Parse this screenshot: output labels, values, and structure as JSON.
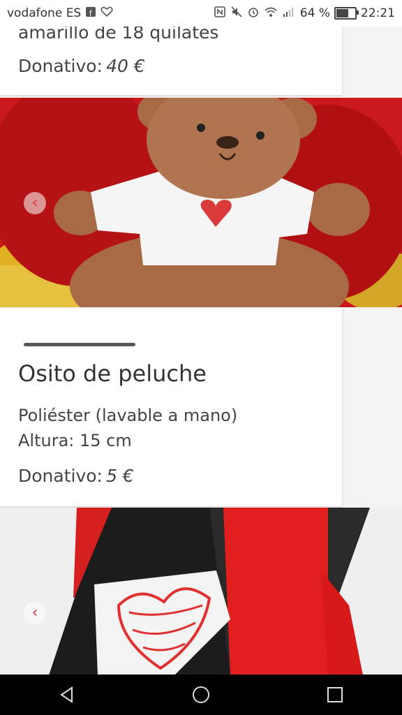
{
  "status_bar": {
    "carrier": "vodafone ES",
    "battery_percent": "64 %",
    "time": "22:21",
    "icons": [
      "facebook-icon",
      "heart-icon",
      "nfc-icon",
      "mute-icon",
      "alarm-icon",
      "wifi-icon",
      "signal-icon",
      "battery-icon"
    ]
  },
  "products": [
    {
      "partial_text": "amarillo de 18 quilates",
      "price_label": "Donativo:",
      "price_value": "40 €"
    },
    {
      "title": "Osito de peluche",
      "desc1": "Poliéster (lavable a mano)",
      "desc2": "Altura: 15 cm",
      "price_label": "Donativo:",
      "price_value": "5 €"
    }
  ],
  "gallery": {
    "prev_arrow": "‹"
  },
  "colors": {
    "accent_red": "#c81c1c",
    "text": "#333333"
  }
}
